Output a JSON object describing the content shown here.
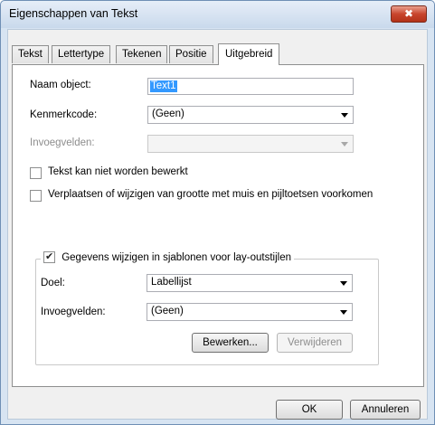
{
  "window": {
    "title": "Eigenschappen van Tekst",
    "close_label": "✖"
  },
  "tabs": [
    {
      "label": "Tekst"
    },
    {
      "label": "Lettertype"
    },
    {
      "label": "Tekenen"
    },
    {
      "label": "Positie"
    },
    {
      "label": "Uitgebreid",
      "active": true
    }
  ],
  "form": {
    "name_label": "Naam object:",
    "name_value": "Text1",
    "code_label": "Kenmerkcode:",
    "code_value": "(Geen)",
    "insert_label": "Invoegvelden:",
    "insert_value": "",
    "no_edit_label": "Tekst kan niet worden bewerkt",
    "no_edit_checked": false,
    "prevent_move_label": "Verplaatsen of wijzigen van grootte met muis en pijltoetsen voorkomen",
    "prevent_move_checked": false
  },
  "group": {
    "legend": "Gegevens wijzigen in sjablonen voor lay-outstijlen",
    "checked": true,
    "target_label": "Doel:",
    "target_value": "Labellijst",
    "fields_label": "Invoegvelden:",
    "fields_value": "(Geen)",
    "edit_button": "Bewerken...",
    "remove_button": "Verwijderen"
  },
  "footer": {
    "ok": "OK",
    "cancel": "Annuleren"
  }
}
